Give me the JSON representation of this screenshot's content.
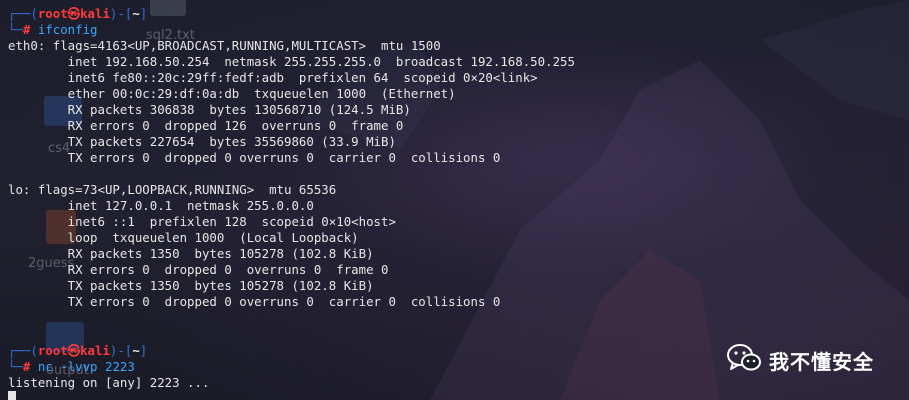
{
  "desktop": {
    "file_labels": [
      "sql2.txt",
      "cs4",
      "2guess",
      "output"
    ]
  },
  "terminal": {
    "prompt1": {
      "corner_top": "┌──(",
      "user": "root㉿kali",
      "mid": ")-[",
      "cwd": "~",
      "end": "]",
      "corner_bottom": "└─",
      "hash": "# ",
      "command": "ifconfig"
    },
    "output_lines": [
      "eth0: flags=4163<UP,BROADCAST,RUNNING,MULTICAST>  mtu 1500",
      "        inet 192.168.50.254  netmask 255.255.255.0  broadcast 192.168.50.255",
      "        inet6 fe80::20c:29ff:fedf:adb  prefixlen 64  scopeid 0×20<link>",
      "        ether 00:0c:29:df:0a:db  txqueuelen 1000  (Ethernet)",
      "        RX packets 306838  bytes 130568710 (124.5 MiB)",
      "        RX errors 0  dropped 126  overruns 0  frame 0",
      "        TX packets 227654  bytes 35569860 (33.9 MiB)",
      "        TX errors 0  dropped 0 overruns 0  carrier 0  collisions 0",
      "",
      "lo: flags=73<UP,LOOPBACK,RUNNING>  mtu 65536",
      "        inet 127.0.0.1  netmask 255.0.0.0",
      "        inet6 ::1  prefixlen 128  scopeid 0×10<host>",
      "        loop  txqueuelen 1000  (Local Loopback)",
      "        RX packets 1350  bytes 105278 (102.8 KiB)",
      "        RX errors 0  dropped 0  overruns 0  frame 0",
      "        TX packets 1350  bytes 105278 (102.8 KiB)",
      "        TX errors 0  dropped 0 overruns 0  carrier 0  collisions 0"
    ],
    "prompt2": {
      "corner_top": "┌──(",
      "user": "root㉿kali",
      "mid": ")-[",
      "cwd": "~",
      "end": "]",
      "corner_bottom": "└─",
      "hash": "# ",
      "command": "nc -lvvp 2223"
    },
    "final_output": "listening on [any] 2223 ..."
  },
  "watermark": {
    "icon": "wechat-icon",
    "text": "我不懂安全"
  },
  "colors": {
    "prompt_frame": "#2f6fd6",
    "prompt_user": "#ff3a3a",
    "command": "#3aa7ff",
    "text": "#e6e6e6"
  }
}
